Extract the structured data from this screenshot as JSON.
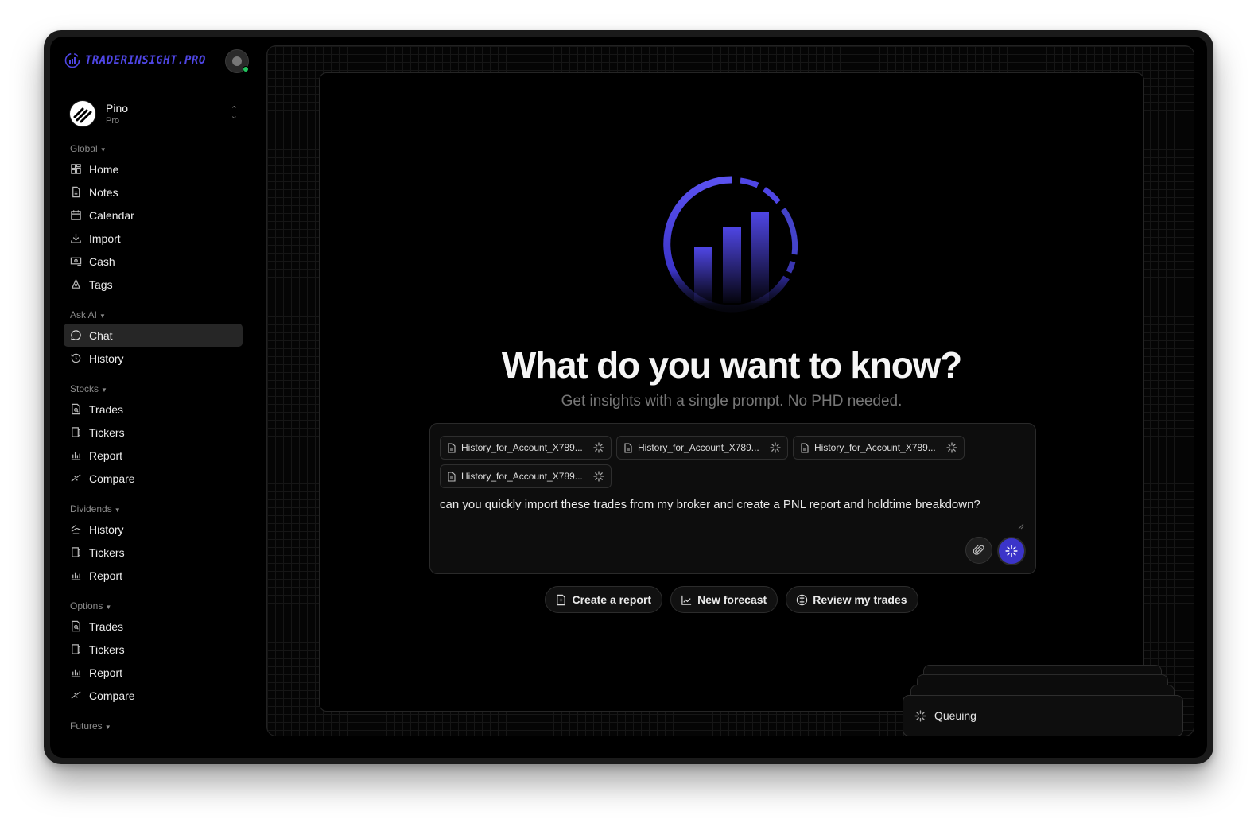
{
  "brand": {
    "name": "TRADERINSIGHT.PRO",
    "accent": "#4f46e5"
  },
  "account": {
    "name": "Pino",
    "plan": "Pro"
  },
  "sidebar": {
    "sections": [
      {
        "title": "Global",
        "items": [
          {
            "label": "Home",
            "icon": "grid-icon"
          },
          {
            "label": "Notes",
            "icon": "document-icon"
          },
          {
            "label": "Calendar",
            "icon": "calendar-icon"
          },
          {
            "label": "Import",
            "icon": "download-icon"
          },
          {
            "label": "Cash",
            "icon": "cash-icon"
          },
          {
            "label": "Tags",
            "icon": "tag-icon"
          }
        ]
      },
      {
        "title": "Ask AI",
        "items": [
          {
            "label": "Chat",
            "icon": "chat-icon",
            "active": true
          },
          {
            "label": "History",
            "icon": "history-icon"
          }
        ]
      },
      {
        "title": "Stocks",
        "items": [
          {
            "label": "Trades",
            "icon": "trades-icon"
          },
          {
            "label": "Tickers",
            "icon": "tickers-icon"
          },
          {
            "label": "Report",
            "icon": "bar-chart-icon"
          },
          {
            "label": "Compare",
            "icon": "compare-icon"
          }
        ]
      },
      {
        "title": "Dividends",
        "items": [
          {
            "label": "History",
            "icon": "dividend-history-icon"
          },
          {
            "label": "Tickers",
            "icon": "tickers-icon"
          },
          {
            "label": "Report",
            "icon": "bar-chart-icon"
          }
        ]
      },
      {
        "title": "Options",
        "items": [
          {
            "label": "Trades",
            "icon": "trades-icon"
          },
          {
            "label": "Tickers",
            "icon": "tickers-icon"
          },
          {
            "label": "Report",
            "icon": "bar-chart-icon"
          },
          {
            "label": "Compare",
            "icon": "compare-icon"
          }
        ]
      },
      {
        "title": "Futures",
        "items": []
      }
    ]
  },
  "main": {
    "title": "What do you want to know?",
    "subtitle": "Get insights with a single prompt. No PHD needed.",
    "attachments": [
      "History_for_Account_X789...",
      "History_for_Account_X789...",
      "History_for_Account_X789...",
      "History_for_Account_X789..."
    ],
    "prompt": "can you quickly import these trades from my broker and create a PNL report and holdtime breakdown?",
    "actions": [
      {
        "label": "Create a report",
        "icon": "report-icon"
      },
      {
        "label": "New forecast",
        "icon": "forecast-icon"
      },
      {
        "label": "Review my trades",
        "icon": "review-icon"
      }
    ]
  },
  "toast": {
    "status": "Queuing"
  }
}
